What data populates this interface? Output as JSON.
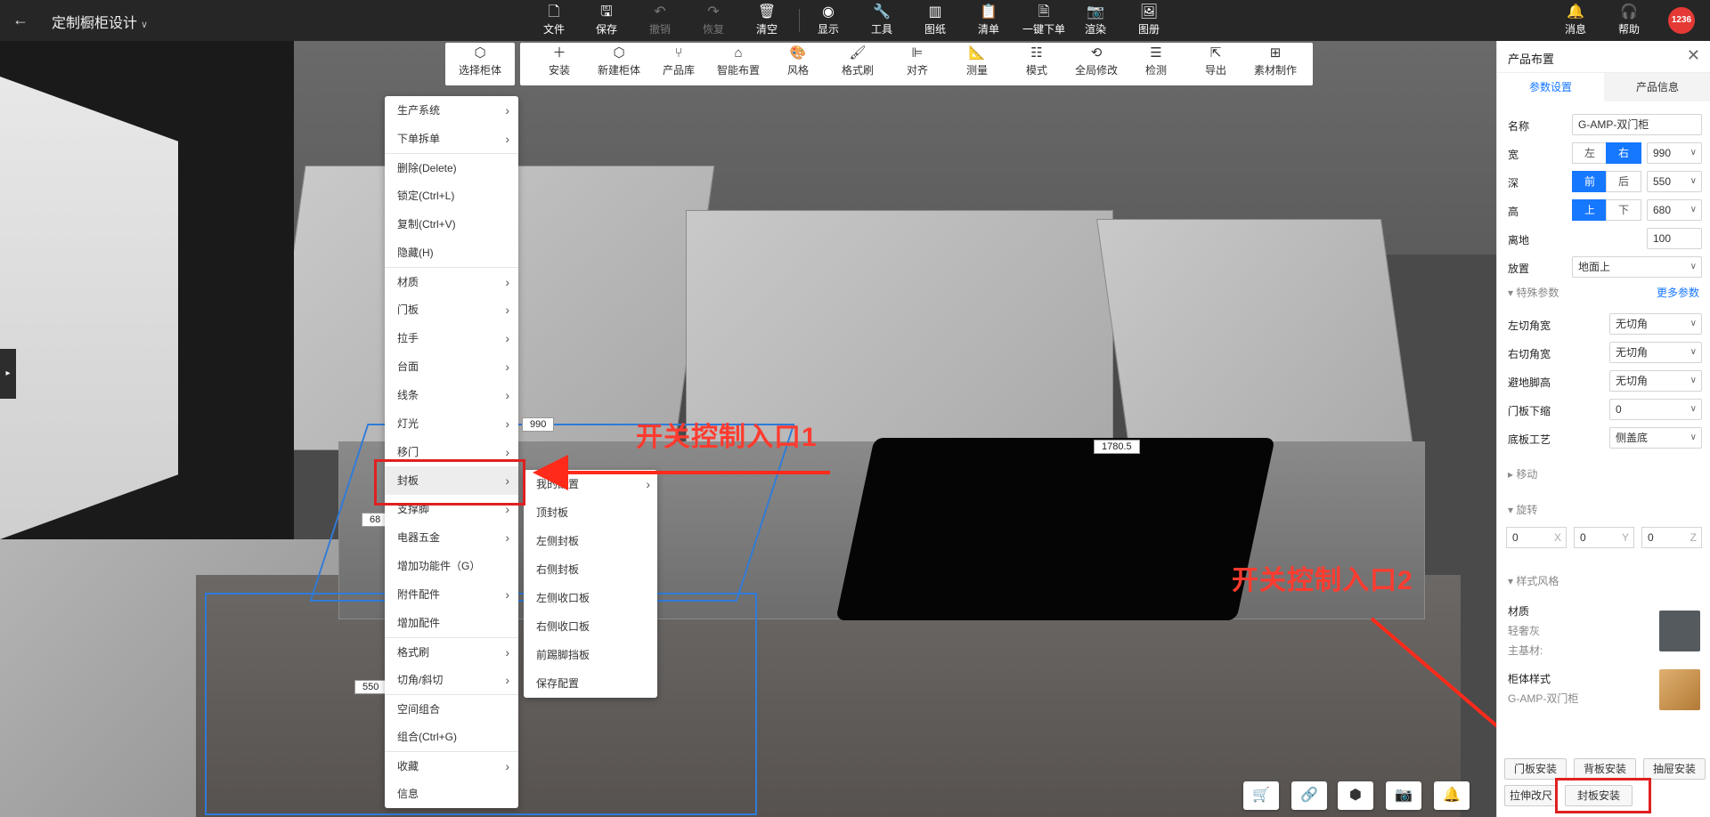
{
  "header": {
    "back_icon": "arrow-left-icon",
    "title": "定制橱柜设计",
    "toolbar": [
      {
        "label": "文件",
        "icon": "file-icon",
        "disabled": false
      },
      {
        "label": "保存",
        "icon": "save-icon",
        "disabled": false
      },
      {
        "label": "撤销",
        "icon": "undo-icon",
        "disabled": true
      },
      {
        "label": "恢复",
        "icon": "redo-icon",
        "disabled": true
      },
      {
        "label": "清空",
        "icon": "clear-icon",
        "disabled": false
      },
      {
        "label": "显示",
        "icon": "eye-icon",
        "disabled": false
      },
      {
        "label": "工具",
        "icon": "wrench-icon",
        "disabled": false
      },
      {
        "label": "图纸",
        "icon": "map-icon",
        "disabled": false
      },
      {
        "label": "清单",
        "icon": "clipboard-icon",
        "disabled": false
      },
      {
        "label": "一键下单",
        "icon": "order-icon",
        "disabled": false
      },
      {
        "label": "渲染",
        "icon": "camera-icon",
        "disabled": false
      },
      {
        "label": "图册",
        "icon": "album-icon",
        "disabled": false
      }
    ],
    "messages_label": "消息",
    "help_label": "帮助",
    "avatar_text": "1236"
  },
  "subtoolbar": {
    "select": {
      "label": "选择柜体",
      "icon": "cube-select-icon"
    },
    "items": [
      {
        "label": "安装",
        "icon": "plus-icon"
      },
      {
        "label": "新建柜体",
        "icon": "cube-icon"
      },
      {
        "label": "产品库",
        "icon": "chair-icon"
      },
      {
        "label": "智能布置",
        "icon": "house-icon"
      },
      {
        "label": "风格",
        "icon": "palette-icon"
      },
      {
        "label": "格式刷",
        "icon": "brush-icon"
      },
      {
        "label": "对齐",
        "icon": "align-icon"
      },
      {
        "label": "测量",
        "icon": "ruler-icon"
      },
      {
        "label": "模式",
        "icon": "grid-icon"
      },
      {
        "label": "全局修改",
        "icon": "global-edit-icon"
      },
      {
        "label": "检测",
        "icon": "check-icon"
      },
      {
        "label": "导出",
        "icon": "export-icon"
      },
      {
        "label": "素材制作",
        "icon": "material-icon"
      }
    ]
  },
  "context_menu": [
    {
      "label": "生产系统",
      "sub": true
    },
    {
      "label": "下单拆单",
      "sub": true
    },
    {
      "label": "删除(Delete)",
      "sub": false
    },
    {
      "label": "锁定(Ctrl+L)",
      "sub": false
    },
    {
      "label": "复制(Ctrl+V)",
      "sub": false
    },
    {
      "label": "隐藏(H)",
      "sub": false
    },
    {
      "label": "材质",
      "sub": true
    },
    {
      "label": "门板",
      "sub": true
    },
    {
      "label": "拉手",
      "sub": true
    },
    {
      "label": "台面",
      "sub": true
    },
    {
      "label": "线条",
      "sub": true
    },
    {
      "label": "灯光",
      "sub": true
    },
    {
      "label": "移门",
      "sub": true
    },
    {
      "label": "封板",
      "sub": true
    },
    {
      "label": "支撑脚",
      "sub": true
    },
    {
      "label": "电器五金",
      "sub": true
    },
    {
      "label": "增加功能件（G）",
      "sub": false
    },
    {
      "label": "附件配件",
      "sub": true
    },
    {
      "label": "增加配件",
      "sub": false
    },
    {
      "label": "格式刷",
      "sub": true
    },
    {
      "label": "切角/斜切",
      "sub": true
    },
    {
      "label": "空间组合",
      "sub": false
    },
    {
      "label": "组合(Ctrl+G)",
      "sub": false
    },
    {
      "label": "收藏",
      "sub": true
    },
    {
      "label": "信息",
      "sub": false
    }
  ],
  "submenu": [
    {
      "label": "我的配置",
      "sub": true
    },
    {
      "label": "顶封板",
      "sub": false
    },
    {
      "label": "左侧封板",
      "sub": false
    },
    {
      "label": "右侧封板",
      "sub": false
    },
    {
      "label": "左侧收口板",
      "sub": false
    },
    {
      "label": "右侧收口板",
      "sub": false
    },
    {
      "label": "前踢脚挡板",
      "sub": false
    },
    {
      "label": "保存配置",
      "sub": false
    }
  ],
  "dimensions": {
    "d1": "990",
    "d2": "68",
    "d3": "550",
    "d4": "1780.5"
  },
  "annotations": {
    "entry1": "开关控制入口1",
    "entry2": "开关控制入口2",
    "color": "#ff3b2f"
  },
  "panel": {
    "title": "产品布置",
    "tabs": [
      "参数设置",
      "产品信息"
    ],
    "name_label": "名称",
    "name_value": "G-AMP-双门柜",
    "width_label": "宽",
    "width_opts": [
      "左",
      "右"
    ],
    "width_value": "990",
    "depth_label": "深",
    "depth_opts": [
      "前",
      "后"
    ],
    "depth_value": "550",
    "height_label": "高",
    "height_opts": [
      "上",
      "下"
    ],
    "height_value": "680",
    "ground_label": "离地",
    "ground_value": "100",
    "place_label": "放置",
    "place_value": "地面上",
    "special_section": "特殊参数",
    "more_params": "更多参数",
    "left_cut_label": "左切角宽",
    "left_cut_value": "无切角",
    "right_cut_label": "右切角宽",
    "right_cut_value": "无切角",
    "avoid_label": "避地脚高",
    "avoid_value": "无切角",
    "door_label": "门板下缩",
    "door_value": "0",
    "bottom_label": "底板工艺",
    "bottom_value": "侧盖底",
    "move_section": "移动",
    "rotate_section": "旋转",
    "rot_x": "0",
    "rot_y": "0",
    "rot_z": "0",
    "axis_x": "X",
    "axis_y": "Y",
    "axis_z": "Z",
    "style_section": "样式风格",
    "material_label": "材质",
    "material_value": "轻奢灰",
    "base_material_label": "主基材:",
    "cabinet_style_label": "柜体样式",
    "cabinet_style_value": "G-AMP-双门柜",
    "buttons": [
      "门板安装",
      "背板安装",
      "抽屉安装",
      "拉伸改尺",
      "封板安装"
    ]
  },
  "bottom_icons": [
    "cart-icon",
    "link-icon",
    "box-icon",
    "camera-refresh-icon",
    "bell-check-icon"
  ],
  "colors": {
    "accent": "#1677ff",
    "annotation": "#e02020",
    "selection": "#2f7bd9"
  }
}
